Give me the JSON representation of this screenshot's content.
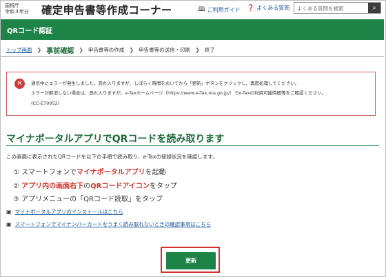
{
  "header": {
    "agency_line1": "国税庁",
    "agency_line2": "令和４年分",
    "site_title": "確定申告書等作成コーナー",
    "guide_link": "ご利用ガイド",
    "faq_link": "よくある質問",
    "search_placeholder": "よくある質問を検索"
  },
  "page_bar": {
    "title": "QRコード認証"
  },
  "breadcrumb": {
    "items": [
      {
        "label": "トップ画面"
      },
      {
        "label": "事前確認"
      },
      {
        "label": "申告書等の作成"
      },
      {
        "label": "申告書等の送信・印刷"
      },
      {
        "label": "終了"
      }
    ]
  },
  "error": {
    "line1": "通信中にエラーが発生しました。恐れ入りますが、しばらく時間をおいてから「更新」ボタンをクリックし、再度処理してください。",
    "line2": "エラーが解消しない場合は、恐れ入りますが、e-Taxホームページ（https://www.e-Tax.nta.go.jp/）でe-Taxの利用可能時間等をご確認ください。",
    "code": "(CC-E70052)"
  },
  "main": {
    "heading": "マイナポータルアプリでQRコードを読み取ります",
    "intro": "この画面に表示されたQRコードを以下の手順で読み取り、e-Taxの登録状況を確認します。",
    "steps": [
      {
        "num": "①",
        "pre": "スマートフォンで",
        "em": "マイナポータルアプリ",
        "post": "を起動"
      },
      {
        "num": "②",
        "em1": "アプリ内の画面右下",
        "mid": "の",
        "em2": "QRコードアイコン",
        "post": "をタップ"
      },
      {
        "num": "③",
        "pre": "アプリメニューの「QRコード読取」をタップ"
      }
    ],
    "links": [
      {
        "label": "マイナポータルアプリのインストールはこちら"
      },
      {
        "label": "スマートフォンでマイナンバーカードをうまく読み取れないときの確認事項はこちら"
      }
    ],
    "update_button": "更新"
  },
  "colors": {
    "brand_green": "#1d8346",
    "error_red": "#d13a3a",
    "emphasis_red": "#d1352b",
    "link_blue": "#1a5a99"
  }
}
